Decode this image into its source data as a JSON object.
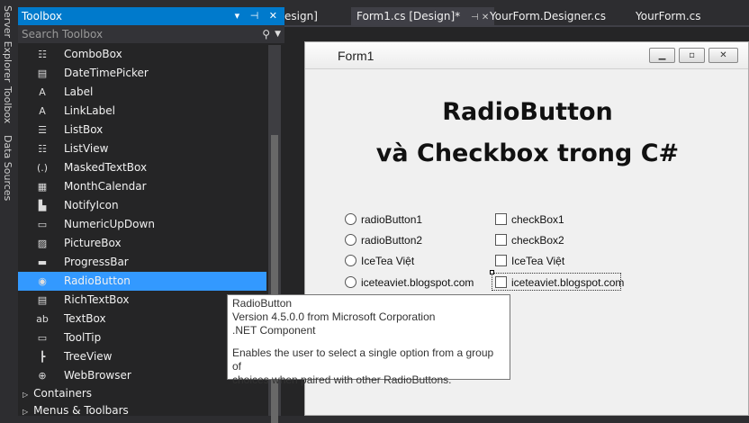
{
  "side_tabs": [
    "Server Explorer",
    "Toolbox",
    "Data Sources"
  ],
  "toolbox": {
    "title": "Toolbox",
    "title_controls": "▾ ⊣ ✕",
    "search_placeholder": "Search Toolbox",
    "items": [
      {
        "label": "ComboBox",
        "icon": "combobox-icon",
        "glyph": "☷"
      },
      {
        "label": "DateTimePicker",
        "icon": "datetimepicker-icon",
        "glyph": "▤"
      },
      {
        "label": "Label",
        "icon": "label-icon",
        "glyph": "A"
      },
      {
        "label": "LinkLabel",
        "icon": "linklabel-icon",
        "glyph": "A"
      },
      {
        "label": "ListBox",
        "icon": "listbox-icon",
        "glyph": "☰"
      },
      {
        "label": "ListView",
        "icon": "listview-icon",
        "glyph": "☷"
      },
      {
        "label": "MaskedTextBox",
        "icon": "maskedtextbox-icon",
        "glyph": "(.)"
      },
      {
        "label": "MonthCalendar",
        "icon": "monthcalendar-icon",
        "glyph": "▦"
      },
      {
        "label": "NotifyIcon",
        "icon": "notifyicon-icon",
        "glyph": "▙"
      },
      {
        "label": "NumericUpDown",
        "icon": "numericupdown-icon",
        "glyph": "▭"
      },
      {
        "label": "PictureBox",
        "icon": "picturebox-icon",
        "glyph": "▨"
      },
      {
        "label": "ProgressBar",
        "icon": "progressbar-icon",
        "glyph": "▬"
      },
      {
        "label": "RadioButton",
        "icon": "radiobutton-icon",
        "glyph": "◉"
      },
      {
        "label": "RichTextBox",
        "icon": "richtextbox-icon",
        "glyph": "▤"
      },
      {
        "label": "TextBox",
        "icon": "textbox-icon",
        "glyph": "ab"
      },
      {
        "label": "ToolTip",
        "icon": "tooltip-icon",
        "glyph": "▭"
      },
      {
        "label": "TreeView",
        "icon": "treeview-icon",
        "glyph": "┣"
      },
      {
        "label": "WebBrowser",
        "icon": "webbrowser-icon",
        "glyph": "⊕"
      }
    ],
    "selected_index": 12,
    "groups": [
      "Containers",
      "Menus & Toolbars"
    ]
  },
  "doc_tabs": [
    "esign]",
    "Form1.cs [Design]*",
    "YourForm.Designer.cs",
    "YourForm.cs"
  ],
  "active_tab_close": "⊣ ✕",
  "form": {
    "title": "Form1",
    "heading_line1": "RadioButton",
    "heading_line2": "và Checkbox trong C#",
    "radios": [
      "radioButton1",
      "radioButton2",
      "IceTea Việt",
      "iceteaviet.blogspot.com"
    ],
    "checks": [
      "checkBox1",
      "checkBox2",
      "IceTea Việt",
      "iceteaviet.blogspot.com"
    ]
  },
  "tooltip": {
    "line1": "RadioButton",
    "line2": "Version 4.5.0.0 from Microsoft Corporation",
    "line3": ".NET Component",
    "line4": "Enables the user to select a single option from a group of",
    "line5": "choices when paired with other RadioButtons."
  },
  "colors": {
    "accent": "#007acc",
    "selected": "#3399ff"
  }
}
